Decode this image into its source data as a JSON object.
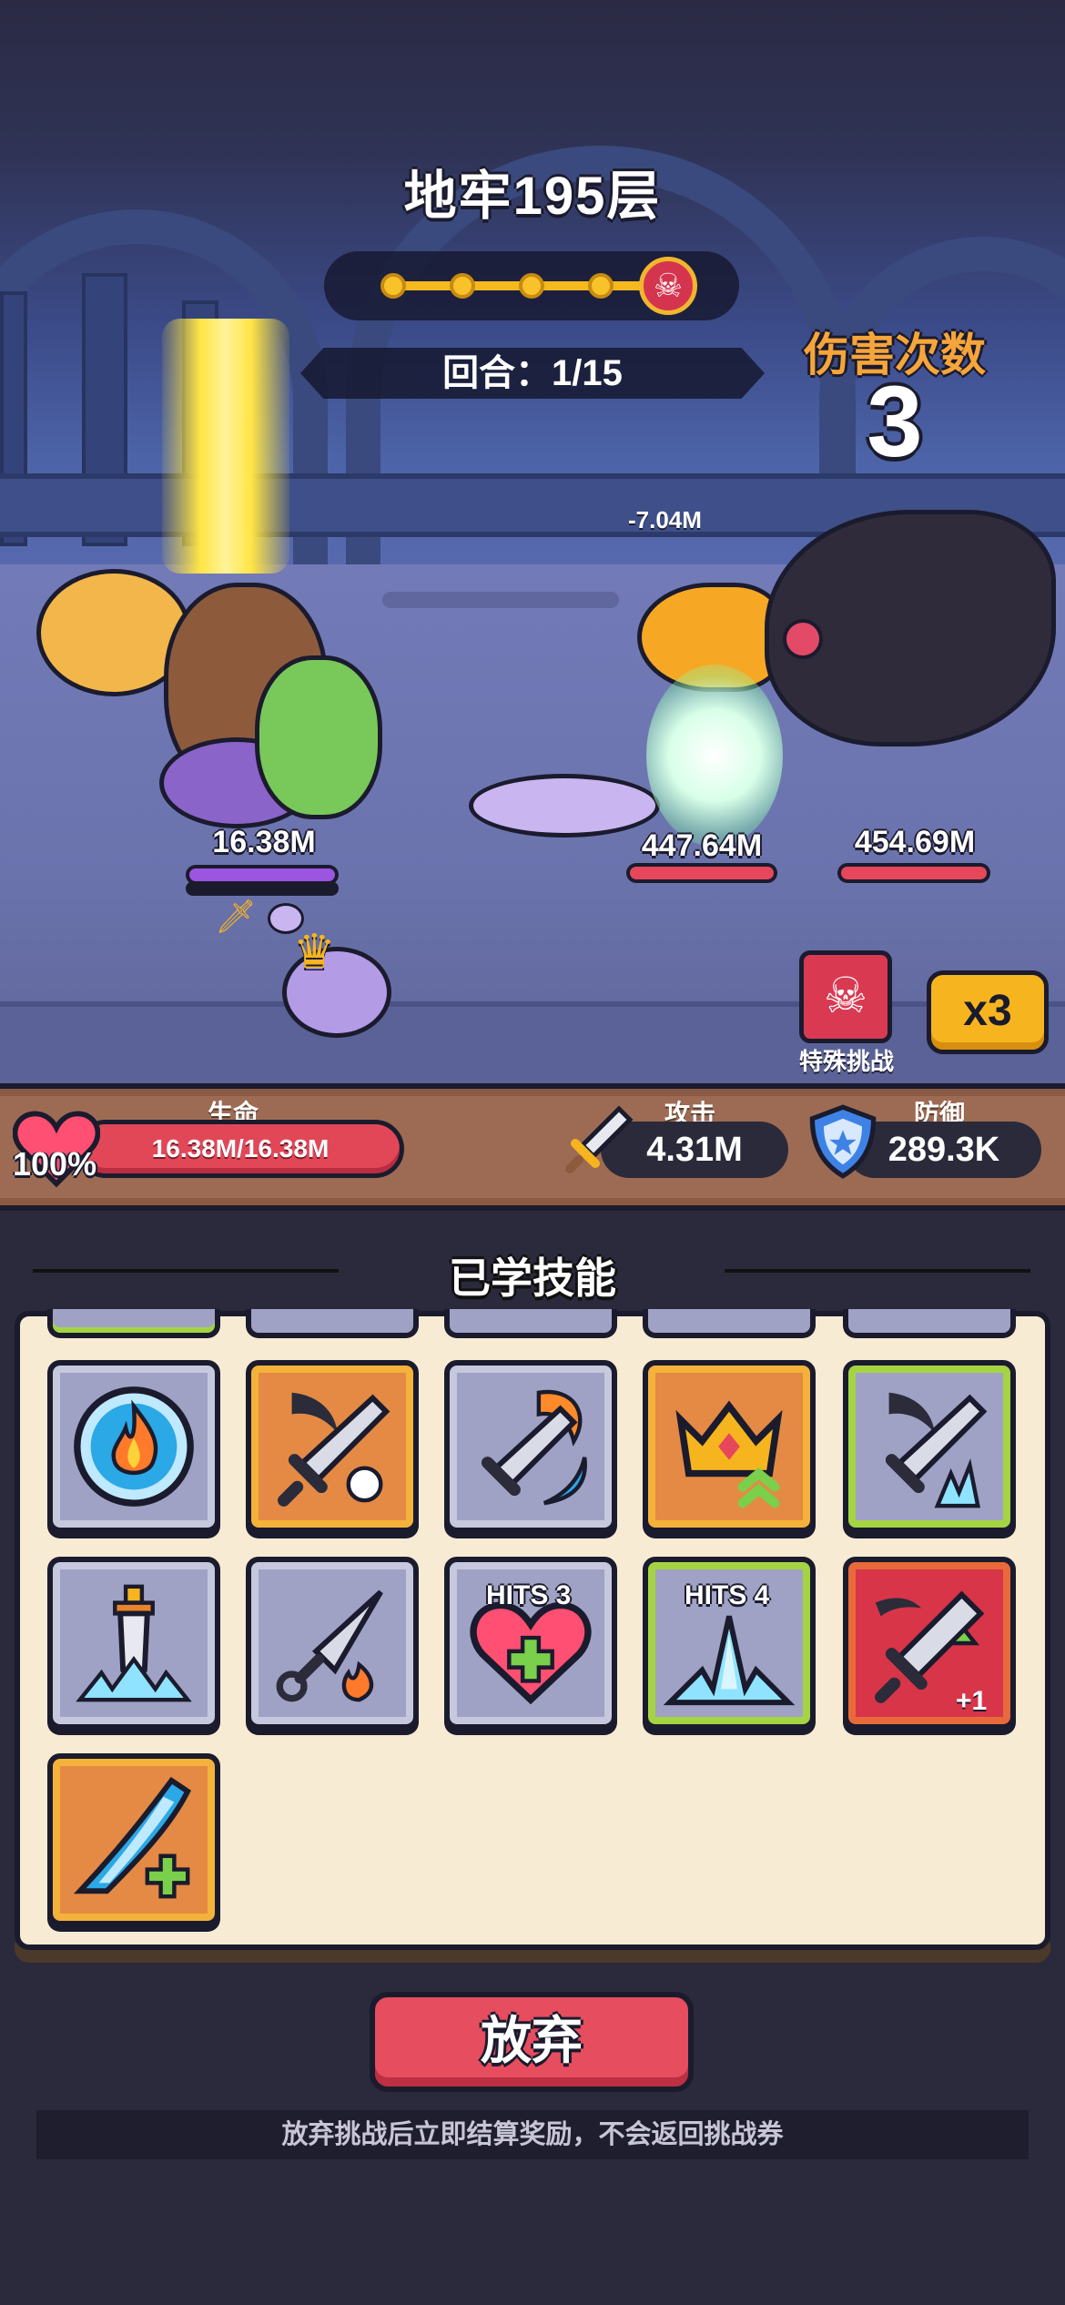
{
  "battle": {
    "level_title": "地牢195层",
    "round_label": "回合：1/15",
    "progress": {
      "current_stage": 1,
      "total_stages": 5,
      "boss_icon": "skull-icon"
    },
    "hits_label": "伤害次数",
    "hits_count": "3",
    "floating_damage": "-7.04M",
    "player_hp": "16.38M",
    "enemies": [
      {
        "name": "hornbill",
        "hp": "447.64M",
        "hp_fraction": 1.0
      },
      {
        "name": "raven",
        "hp": "454.69M",
        "hp_fraction": 1.0
      }
    ],
    "special_challenge_label": "特殊挑战",
    "speed_label": "x3"
  },
  "stats": {
    "life_title": "生命",
    "life_percent": "100%",
    "life_value": "16.38M/16.38M",
    "life_fraction": 1.0,
    "attack_title": "攻击",
    "attack_value": "4.31M",
    "defense_title": "防御",
    "defense_value": "289.3K"
  },
  "skills_section": {
    "title": "已学技能",
    "skills": [
      {
        "icon": "fire-orb-icon",
        "frame": "gray"
      },
      {
        "icon": "scythe-sword-skull-icon",
        "frame": "orange"
      },
      {
        "icon": "flaming-sword-wave-icon",
        "frame": "gray"
      },
      {
        "icon": "crown-upgrade-icon",
        "frame": "orange"
      },
      {
        "icon": "scythe-sword-ice-icon",
        "frame": "green"
      },
      {
        "icon": "sword-ice-burst-icon",
        "frame": "gray"
      },
      {
        "icon": "kunai-fire-icon",
        "frame": "gray"
      },
      {
        "icon": "heart-heal-icon",
        "frame": "gray",
        "tag": "HITS 3"
      },
      {
        "icon": "ice-spike-icon",
        "frame": "green",
        "tag": "HITS 4"
      },
      {
        "icon": "sword-plus-one-icon",
        "frame": "red",
        "tag": "+1"
      },
      {
        "icon": "water-slash-heal-icon",
        "frame": "orange"
      }
    ]
  },
  "footer": {
    "abandon_label": "放弃",
    "notice": "放弃挑战后立即结算奖励，不会返回挑战券"
  }
}
